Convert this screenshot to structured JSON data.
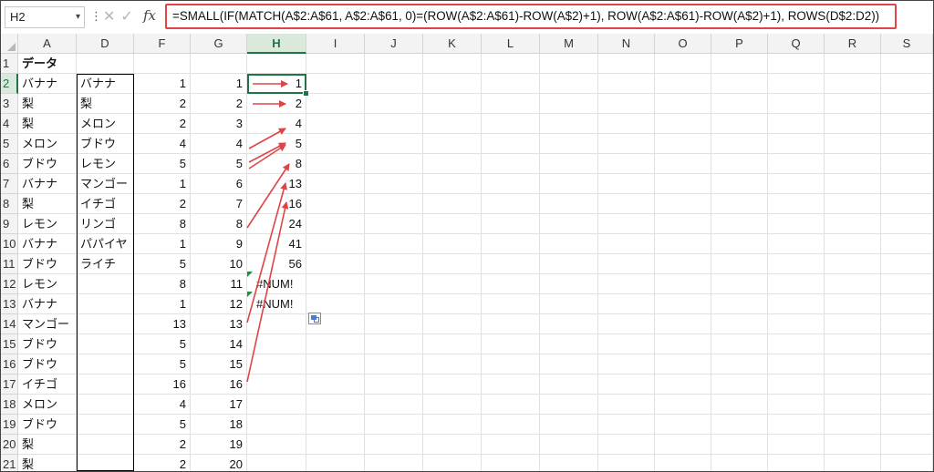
{
  "name_box": "H2",
  "formula": "=SMALL(IF(MATCH(A$2:A$61, A$2:A$61, 0)=(ROW(A$2:A$61)-ROW(A$2)+1), ROW(A$2:A$61)-ROW(A$2)+1), ROWS(D$2:D2))",
  "fx_label": "fx",
  "columns": [
    "A",
    "D",
    "F",
    "G",
    "H",
    "I",
    "J",
    "K",
    "L",
    "M",
    "N",
    "O",
    "P",
    "Q",
    "R",
    "S"
  ],
  "rows": [
    {
      "n": "1",
      "A": "データ",
      "D": "",
      "F": "",
      "G": "",
      "H": ""
    },
    {
      "n": "2",
      "A": "バナナ",
      "D": "バナナ",
      "F": "1",
      "G": "1",
      "H": "1"
    },
    {
      "n": "3",
      "A": "梨",
      "D": "梨",
      "F": "2",
      "G": "2",
      "H": "2"
    },
    {
      "n": "4",
      "A": "梨",
      "D": "メロン",
      "F": "2",
      "G": "3",
      "H": "4"
    },
    {
      "n": "5",
      "A": "メロン",
      "D": "ブドウ",
      "F": "4",
      "G": "4",
      "H": "5"
    },
    {
      "n": "6",
      "A": "ブドウ",
      "D": "レモン",
      "F": "5",
      "G": "5",
      "H": "8"
    },
    {
      "n": "7",
      "A": "バナナ",
      "D": "マンゴー",
      "F": "1",
      "G": "6",
      "H": "13"
    },
    {
      "n": "8",
      "A": "梨",
      "D": "イチゴ",
      "F": "2",
      "G": "7",
      "H": "16"
    },
    {
      "n": "9",
      "A": "レモン",
      "D": "リンゴ",
      "F": "8",
      "G": "8",
      "H": "24"
    },
    {
      "n": "10",
      "A": "バナナ",
      "D": "パパイヤ",
      "F": "1",
      "G": "9",
      "H": "41"
    },
    {
      "n": "11",
      "A": "ブドウ",
      "D": "ライチ",
      "F": "5",
      "G": "10",
      "H": "56"
    },
    {
      "n": "12",
      "A": "レモン",
      "D": "",
      "F": "8",
      "G": "11",
      "H": "#NUM!"
    },
    {
      "n": "13",
      "A": "バナナ",
      "D": "",
      "F": "1",
      "G": "12",
      "H": "#NUM!"
    },
    {
      "n": "14",
      "A": "マンゴー",
      "D": "",
      "F": "13",
      "G": "13",
      "H": ""
    },
    {
      "n": "15",
      "A": "ブドウ",
      "D": "",
      "F": "5",
      "G": "14",
      "H": ""
    },
    {
      "n": "16",
      "A": "ブドウ",
      "D": "",
      "F": "5",
      "G": "15",
      "H": ""
    },
    {
      "n": "17",
      "A": "イチゴ",
      "D": "",
      "F": "16",
      "G": "16",
      "H": ""
    },
    {
      "n": "18",
      "A": "メロン",
      "D": "",
      "F": "4",
      "G": "17",
      "H": ""
    },
    {
      "n": "19",
      "A": "ブドウ",
      "D": "",
      "F": "5",
      "G": "18",
      "H": ""
    },
    {
      "n": "20",
      "A": "梨",
      "D": "",
      "F": "2",
      "G": "19",
      "H": ""
    },
    {
      "n": "21",
      "A": "梨",
      "D": "",
      "F": "2",
      "G": "20",
      "H": ""
    }
  ],
  "arrow_color": "#e04545",
  "selection_color": "#217346"
}
